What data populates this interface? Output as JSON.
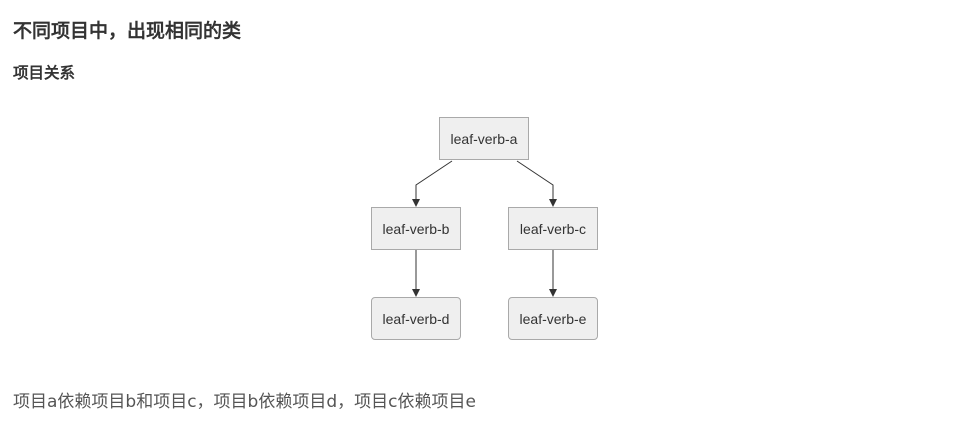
{
  "heading": "不同项目中，出现相同的类",
  "subheading": "项目关系",
  "diagram": {
    "nodes": {
      "a": "leaf-verb-a",
      "b": "leaf-verb-b",
      "c": "leaf-verb-c",
      "d": "leaf-verb-d",
      "e": "leaf-verb-e"
    },
    "edges": [
      {
        "from": "leaf-verb-a",
        "to": "leaf-verb-b"
      },
      {
        "from": "leaf-verb-a",
        "to": "leaf-verb-c"
      },
      {
        "from": "leaf-verb-b",
        "to": "leaf-verb-d"
      },
      {
        "from": "leaf-verb-c",
        "to": "leaf-verb-e"
      }
    ]
  },
  "description": "项目a依赖项目b和项目c，项目b依赖项目d，项目c依赖项目e"
}
